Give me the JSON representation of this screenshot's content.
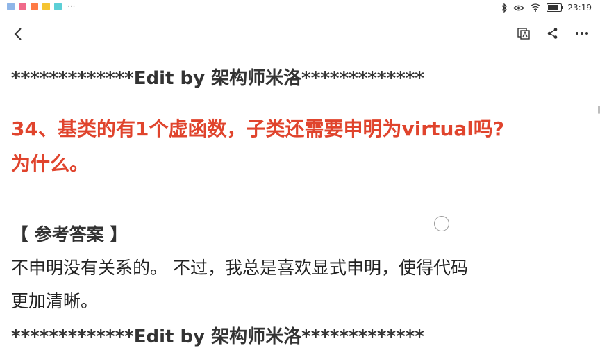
{
  "status_bar": {
    "time": "23:19",
    "notification_icons": [
      "map-icon",
      "mail-icon",
      "video-icon",
      "app-icon",
      "app-icon"
    ],
    "overflow": "···",
    "indicators": [
      "bluetooth-icon",
      "eye-icon",
      "wifi-icon",
      "battery-icon"
    ],
    "battery_level": 0.7
  },
  "toolbar": {
    "back": "back-icon",
    "actions": [
      "translate-icon",
      "share-icon",
      "more-icon"
    ]
  },
  "article": {
    "separator_top": "*************Edit by 架构师米洛*************",
    "question_line1": "34、基类的有1个虚函数，子类还需要申明为virtual吗?",
    "question_line2": "为什么。",
    "answer_heading": "【 参考答案 】",
    "answer_line1": "不申明没有关系的。 不过，我总是喜欢显式申明，使得代码",
    "answer_line2": "更加清晰。",
    "separator_bottom": "*************Edit by 架构师米洛*************"
  },
  "colors": {
    "question": "#e0442d",
    "text": "#222222",
    "background": "#ffffff"
  }
}
